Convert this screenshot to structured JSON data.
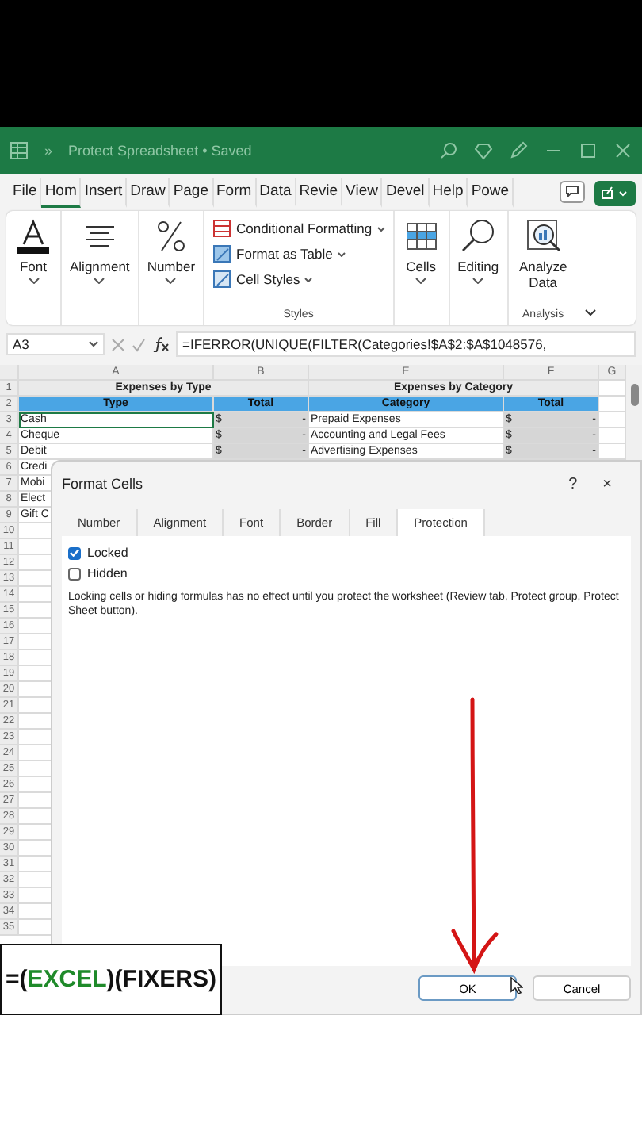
{
  "title_bar": {
    "title": "Protect Spreadsheet • Saved",
    "overflow": "»"
  },
  "menu_tabs": [
    {
      "label": "File",
      "selected": false
    },
    {
      "label": "Hom",
      "selected": true
    },
    {
      "label": "Insert",
      "selected": false
    },
    {
      "label": "Draw",
      "selected": false
    },
    {
      "label": "Page",
      "selected": false
    },
    {
      "label": "Form",
      "selected": false
    },
    {
      "label": "Data",
      "selected": false
    },
    {
      "label": "Revie",
      "selected": false
    },
    {
      "label": "View",
      "selected": false
    },
    {
      "label": "Devel",
      "selected": false
    },
    {
      "label": "Help",
      "selected": false
    },
    {
      "label": "Powe",
      "selected": false
    }
  ],
  "ribbon": {
    "font": "Font",
    "alignment": "Alignment",
    "number": "Number",
    "styles": {
      "items": [
        "Conditional Formatting",
        "Format as Table",
        "Cell Styles"
      ],
      "label": "Styles"
    },
    "cells": "Cells",
    "editing": "Editing",
    "analyze": "Analyze Data",
    "analysis_label": "Analysis"
  },
  "formula_bar": {
    "name_box": "A3",
    "formula": "=IFERROR(UNIQUE(FILTER(Categories!$A$2:$A$1048576,"
  },
  "sheet": {
    "columns": [
      "A",
      "B",
      "E",
      "F",
      "G"
    ],
    "title_row": {
      "number": "1",
      "titles": [
        "Expenses by Type",
        "Expenses by Category"
      ]
    },
    "header_row": {
      "number": "2",
      "cells": [
        "Type",
        "Total",
        "Category",
        "Total"
      ]
    },
    "rows": [
      {
        "number": "3",
        "cells": [
          "Cash",
          "$",
          "-",
          "Prepaid Expenses",
          "$",
          "-"
        ],
        "selected": true
      },
      {
        "number": "4",
        "cells": [
          "Cheque",
          "$",
          "-",
          "Accounting and Legal Fees",
          "$",
          "-"
        ],
        "selected": false
      },
      {
        "number": "5",
        "cells": [
          "Debit",
          "$",
          "-",
          "Advertising Expenses",
          "$",
          "-"
        ],
        "selected": false
      },
      {
        "number": "6",
        "cells": [
          "Credi"
        ],
        "selected": false
      },
      {
        "number": "7",
        "cells": [
          "Mobi"
        ],
        "selected": false
      },
      {
        "number": "8",
        "cells": [
          "Elect"
        ],
        "selected": false
      },
      {
        "number": "9",
        "cells": [
          "Gift C"
        ],
        "selected": false
      },
      {
        "number": "10"
      },
      {
        "number": "11"
      },
      {
        "number": "12"
      },
      {
        "number": "13"
      },
      {
        "number": "14"
      },
      {
        "number": "15"
      },
      {
        "number": "16"
      },
      {
        "number": "17"
      },
      {
        "number": "18"
      },
      {
        "number": "19"
      },
      {
        "number": "20"
      },
      {
        "number": "21"
      },
      {
        "number": "22"
      },
      {
        "number": "23"
      },
      {
        "number": "24"
      },
      {
        "number": "25"
      },
      {
        "number": "26"
      },
      {
        "number": "27"
      },
      {
        "number": "28"
      },
      {
        "number": "29"
      },
      {
        "number": "30"
      },
      {
        "number": "31"
      },
      {
        "number": "32"
      },
      {
        "number": "33"
      },
      {
        "number": "34"
      },
      {
        "number": "35"
      }
    ]
  },
  "dialog": {
    "title": "Format Cells",
    "help": "?",
    "close": "×",
    "tabs": [
      {
        "label": "Number",
        "selected": false
      },
      {
        "label": "Alignment",
        "selected": false
      },
      {
        "label": "Font",
        "selected": false
      },
      {
        "label": "Border",
        "selected": false
      },
      {
        "label": "Fill",
        "selected": false
      },
      {
        "label": "Protection",
        "selected": true
      }
    ],
    "options": [
      {
        "label": "Locked",
        "checked": true
      },
      {
        "label": "Hidden",
        "checked": false
      }
    ],
    "note": "Locking cells or hiding formulas has no effect until you protect the worksheet (Review tab, Protect group, Protect Sheet button).",
    "buttons": [
      {
        "label": "OK",
        "kind": "default"
      },
      {
        "label": "Cancel",
        "kind": "normal"
      }
    ]
  },
  "logo": {
    "prefix": "=(",
    "accent": "EXCEL",
    "suffix": ")(FIXERS)"
  }
}
